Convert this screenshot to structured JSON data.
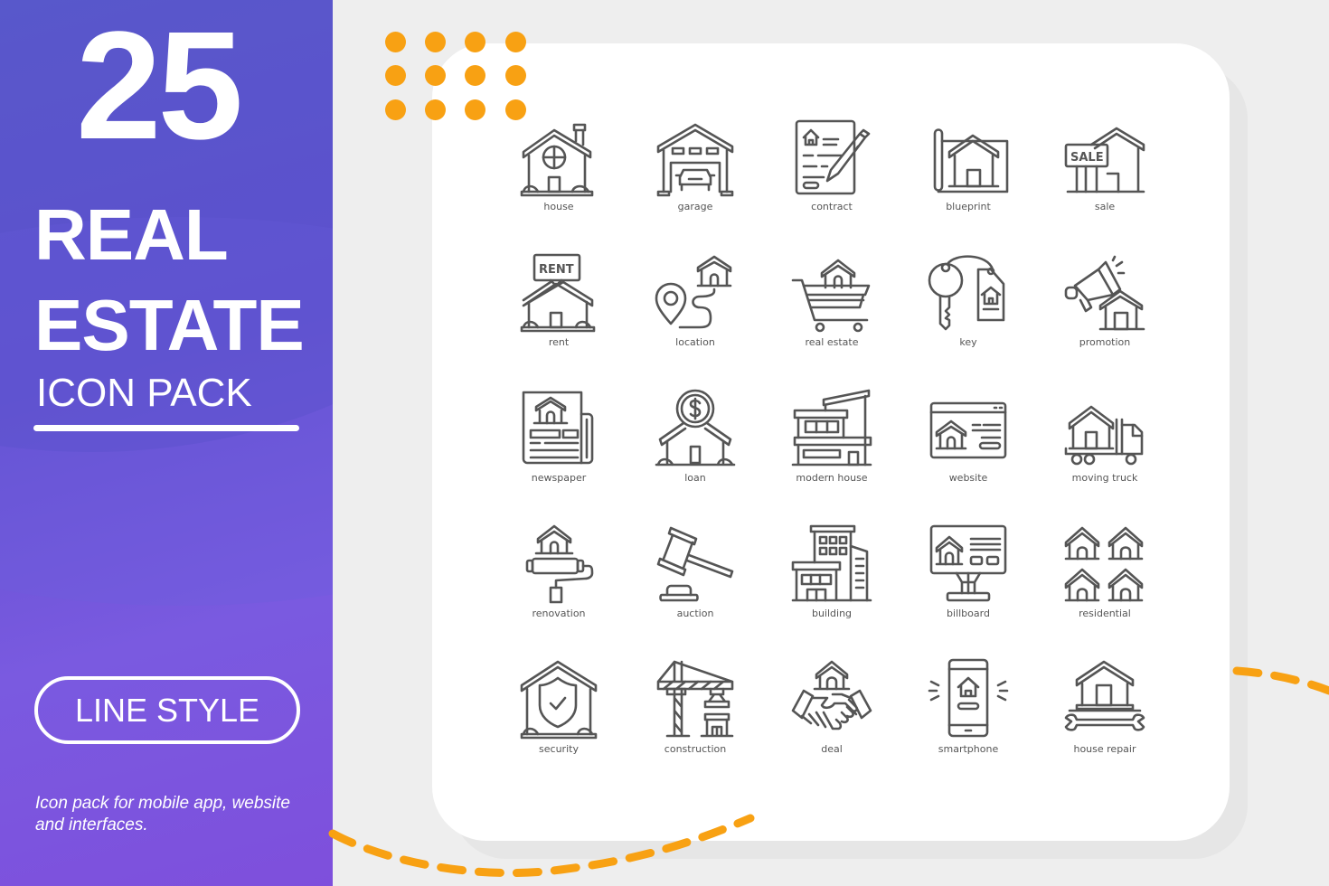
{
  "banner": {
    "count": "25",
    "title_line1": "REAL",
    "title_line2": "ESTATE",
    "subtitle": "ICON PACK",
    "style_badge": "LINE STYLE",
    "description": "Icon pack for mobile app, website and interfaces."
  },
  "colors": {
    "accent_orange": "#f8a113",
    "panel_purple": "#6150d0",
    "icon_stroke": "#555555",
    "background": "#eeeeee",
    "card": "#ffffff"
  },
  "icons": [
    {
      "name": "house",
      "label": "house",
      "icon": "house-icon"
    },
    {
      "name": "garage",
      "label": "garage",
      "icon": "garage-icon"
    },
    {
      "name": "contract",
      "label": "contract",
      "icon": "contract-icon"
    },
    {
      "name": "blueprint",
      "label": "blueprint",
      "icon": "blueprint-icon"
    },
    {
      "name": "sale",
      "label": "sale",
      "icon": "sale-icon",
      "sign_text": "SALE"
    },
    {
      "name": "rent",
      "label": "rent",
      "icon": "rent-icon",
      "sign_text": "RENT"
    },
    {
      "name": "location",
      "label": "location",
      "icon": "location-icon"
    },
    {
      "name": "real-estate",
      "label": "real estate",
      "icon": "cart-house-icon"
    },
    {
      "name": "key",
      "label": "key",
      "icon": "key-icon"
    },
    {
      "name": "promotion",
      "label": "promotion",
      "icon": "megaphone-icon"
    },
    {
      "name": "newspaper",
      "label": "newspaper",
      "icon": "newspaper-icon"
    },
    {
      "name": "loan",
      "label": "loan",
      "icon": "loan-icon"
    },
    {
      "name": "modern-house",
      "label": "modern house",
      "icon": "modern-house-icon"
    },
    {
      "name": "website",
      "label": "website",
      "icon": "website-icon"
    },
    {
      "name": "moving-truck",
      "label": "moving truck",
      "icon": "truck-icon"
    },
    {
      "name": "renovation",
      "label": "renovation",
      "icon": "paint-roller-icon"
    },
    {
      "name": "auction",
      "label": "auction",
      "icon": "gavel-icon"
    },
    {
      "name": "building",
      "label": "building",
      "icon": "building-icon"
    },
    {
      "name": "billboard",
      "label": "billboard",
      "icon": "billboard-icon"
    },
    {
      "name": "residential",
      "label": "residential",
      "icon": "residential-icon"
    },
    {
      "name": "security",
      "label": "security",
      "icon": "shield-house-icon"
    },
    {
      "name": "construction",
      "label": "construction",
      "icon": "crane-icon"
    },
    {
      "name": "deal",
      "label": "deal",
      "icon": "handshake-icon"
    },
    {
      "name": "smartphone",
      "label": "smartphone",
      "icon": "smartphone-icon"
    },
    {
      "name": "house-repair",
      "label": "house repair",
      "icon": "wrench-house-icon"
    }
  ]
}
